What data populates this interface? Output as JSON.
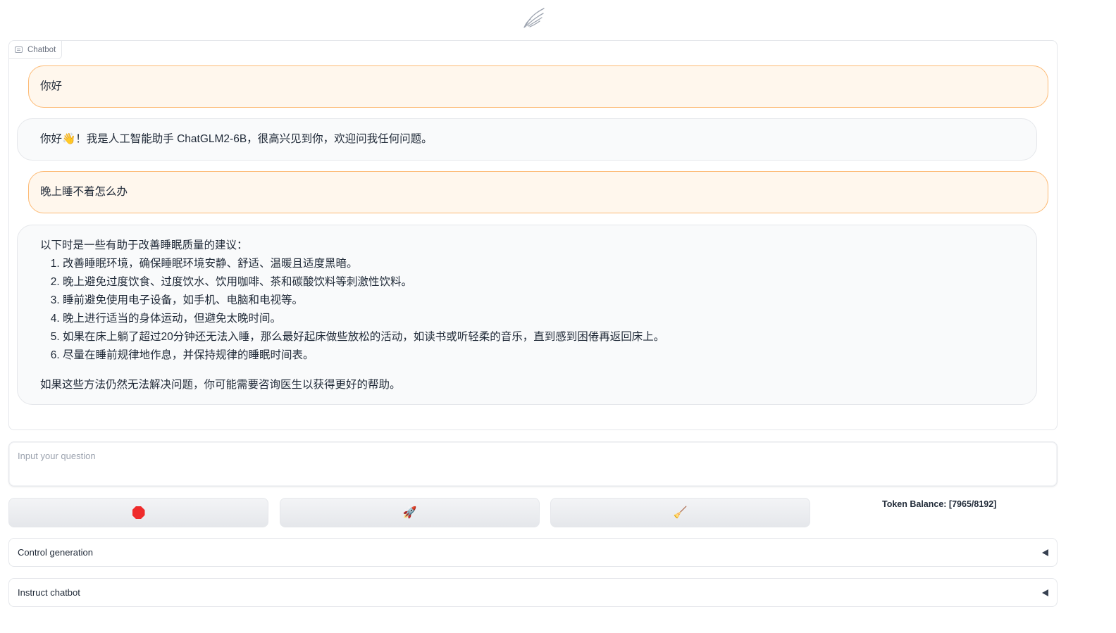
{
  "header": {
    "logo_icon": "wings-logo-icon"
  },
  "chatbot": {
    "label": "Chatbot",
    "messages": [
      {
        "role": "user",
        "text": "你好"
      },
      {
        "role": "bot",
        "text": "你好👋！我是人工智能助手 ChatGLM2-6B，很高兴见到你，欢迎问我任何问题。"
      },
      {
        "role": "user",
        "text": "晚上睡不着怎么办"
      },
      {
        "role": "bot",
        "intro": "以下时是一些有助于改善睡眠质量的建议：",
        "items": [
          "改善睡眠环境，确保睡眠环境安静、舒适、温暖且适度黑暗。",
          "晚上避免过度饮食、过度饮水、饮用咖啡、茶和碳酸饮料等刺激性饮料。",
          "睡前避免使用电子设备，如手机、电脑和电视等。",
          "晚上进行适当的身体运动，但避免太晚时间。",
          "如果在床上躺了超过20分钟还无法入睡，那么最好起床做些放松的活动，如读书或听轻柔的音乐，直到感到困倦再返回床上。",
          "尽量在睡前规律地作息，并保持规律的睡眠时间表。"
        ],
        "outro": "如果这些方法仍然无法解决问题，你可能需要咨询医生以获得更好的帮助。"
      }
    ]
  },
  "input": {
    "placeholder": "Input your question",
    "value": ""
  },
  "buttons": {
    "stop": {
      "icon": "stop-sign-icon"
    },
    "send": {
      "icon": "rocket-icon",
      "glyph": "🚀"
    },
    "clear": {
      "icon": "broom-icon",
      "glyph": "🧹"
    }
  },
  "token_balance": "Token Balance: [7965/8192]",
  "accordions": [
    {
      "label": "Control generation",
      "state": "collapsed"
    },
    {
      "label": "Instruct chatbot",
      "state": "collapsed"
    }
  ],
  "colors": {
    "user_bubble_bg": "#fff7ed",
    "user_bubble_border": "#fdba74",
    "bot_bubble_bg": "#f9fafb",
    "stop_red": "#ef2b2b"
  }
}
